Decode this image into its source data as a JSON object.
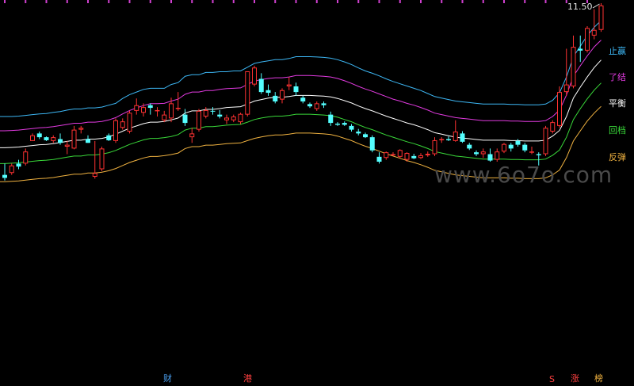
{
  "chart_data": {
    "type": "candlestick",
    "ylim": [
      4.74,
      11.56
    ],
    "last_price_label": "11.50",
    "watermark": "www.6o7o.com",
    "band_labels": [
      {
        "text": "止赢",
        "color": "#3db7f5"
      },
      {
        "text": "了结",
        "color": "#e23ae0"
      },
      {
        "text": "平衡",
        "color": "#ffffff"
      },
      {
        "text": "回档",
        "color": "#39d839"
      },
      {
        "text": "反弹",
        "color": "#f0b240"
      }
    ],
    "bottom_markers": [
      {
        "text": "财",
        "color": "#4a9ff0"
      },
      {
        "text": "港",
        "color": "#ff4040"
      },
      {
        "text": "S",
        "color": "#ff4040"
      },
      {
        "text": "涨",
        "color": "#ff4040"
      },
      {
        "text": "榜",
        "color": "#f0b240"
      }
    ],
    "candles": [
      [
        7.0,
        7.3,
        6.85,
        6.92
      ],
      [
        7.05,
        7.3,
        7.0,
        7.25
      ],
      [
        7.3,
        7.4,
        7.15,
        7.22
      ],
      [
        7.3,
        7.7,
        7.25,
        7.62
      ],
      [
        7.9,
        8.1,
        7.9,
        8.05
      ],
      [
        8.1,
        8.15,
        7.95,
        8.0
      ],
      [
        8.0,
        8.02,
        7.9,
        7.92
      ],
      [
        7.9,
        8.05,
        7.85,
        8.0
      ],
      [
        7.95,
        8.1,
        7.8,
        7.85
      ],
      [
        7.75,
        7.9,
        7.55,
        7.8
      ],
      [
        7.7,
        8.3,
        7.68,
        8.2
      ],
      [
        8.2,
        8.3,
        8.1,
        8.25
      ],
      [
        7.95,
        8.05,
        7.85,
        7.85
      ],
      [
        6.95,
        7.9,
        6.9,
        7.05
      ],
      [
        7.15,
        7.75,
        7.1,
        7.7
      ],
      [
        8.05,
        8.1,
        7.9,
        7.92
      ],
      [
        7.9,
        8.5,
        7.85,
        8.45
      ],
      [
        8.25,
        8.5,
        8.2,
        8.42
      ],
      [
        8.15,
        8.7,
        8.1,
        8.65
      ],
      [
        8.7,
        9.03,
        8.6,
        8.85
      ],
      [
        8.65,
        8.9,
        8.55,
        8.8
      ],
      [
        8.85,
        8.9,
        8.6,
        8.78
      ],
      [
        8.7,
        8.8,
        8.55,
        8.72
      ],
      [
        8.45,
        8.7,
        8.4,
        8.6
      ],
      [
        8.5,
        9.05,
        8.4,
        8.9
      ],
      [
        8.75,
        9.2,
        8.7,
        8.78
      ],
      [
        8.6,
        8.75,
        8.3,
        8.38
      ],
      [
        8.0,
        8.25,
        7.85,
        8.1
      ],
      [
        8.2,
        8.75,
        8.15,
        8.7
      ],
      [
        8.55,
        8.8,
        8.5,
        8.72
      ],
      [
        8.7,
        8.8,
        8.6,
        8.68
      ],
      [
        8.6,
        8.72,
        8.5,
        8.55
      ],
      [
        8.45,
        8.6,
        8.35,
        8.52
      ],
      [
        8.45,
        8.6,
        8.4,
        8.55
      ],
      [
        8.4,
        8.65,
        8.35,
        8.62
      ],
      [
        8.6,
        9.75,
        8.55,
        9.75
      ],
      [
        9.4,
        9.9,
        9.35,
        9.85
      ],
      [
        9.55,
        9.7,
        9.15,
        9.2
      ],
      [
        9.25,
        9.4,
        9.1,
        9.18
      ],
      [
        9.1,
        9.2,
        8.9,
        8.95
      ],
      [
        9.0,
        9.3,
        8.9,
        9.25
      ],
      [
        9.35,
        9.6,
        9.25,
        9.4
      ],
      [
        9.35,
        9.45,
        9.1,
        9.2
      ],
      [
        9.05,
        9.1,
        8.9,
        8.95
      ],
      [
        8.88,
        8.92,
        8.78,
        8.82
      ],
      [
        8.75,
        8.95,
        8.7,
        8.9
      ],
      [
        8.9,
        8.95,
        8.78,
        8.85
      ],
      [
        8.6,
        8.68,
        8.3,
        8.38
      ],
      [
        8.36,
        8.4,
        8.3,
        8.33
      ],
      [
        8.38,
        8.42,
        8.3,
        8.33
      ],
      [
        8.3,
        8.35,
        8.15,
        8.2
      ],
      [
        8.15,
        8.22,
        8.05,
        8.1
      ],
      [
        8.08,
        8.12,
        7.98,
        8.0
      ],
      [
        8.0,
        8.05,
        7.6,
        7.65
      ],
      [
        7.48,
        7.6,
        7.3,
        7.35
      ],
      [
        7.45,
        7.62,
        7.4,
        7.6
      ],
      [
        7.55,
        7.6,
        7.5,
        7.55
      ],
      [
        7.48,
        7.68,
        7.44,
        7.66
      ],
      [
        7.4,
        7.6,
        7.35,
        7.58
      ],
      [
        7.5,
        7.56,
        7.42,
        7.44
      ],
      [
        7.45,
        7.58,
        7.42,
        7.52
      ],
      [
        7.52,
        7.62,
        7.48,
        7.56
      ],
      [
        7.55,
        8.0,
        7.5,
        7.92
      ],
      [
        7.92,
        8.0,
        7.85,
        7.95
      ],
      [
        7.95,
        8.02,
        7.9,
        7.92
      ],
      [
        7.9,
        8.45,
        7.88,
        8.15
      ],
      [
        8.1,
        8.16,
        7.85,
        7.88
      ],
      [
        7.8,
        7.85,
        7.66,
        7.7
      ],
      [
        7.6,
        7.65,
        7.5,
        7.55
      ],
      [
        7.55,
        7.7,
        7.45,
        7.62
      ],
      [
        7.55,
        7.7,
        7.35,
        7.38
      ],
      [
        7.4,
        7.7,
        7.35,
        7.62
      ],
      [
        7.62,
        7.85,
        7.58,
        7.82
      ],
      [
        7.8,
        7.85,
        7.62,
        7.7
      ],
      [
        7.9,
        7.95,
        7.75,
        7.8
      ],
      [
        7.8,
        7.85,
        7.6,
        7.65
      ],
      [
        7.6,
        7.75,
        7.55,
        7.62
      ],
      [
        7.55,
        7.6,
        7.25,
        7.52
      ],
      [
        7.55,
        8.3,
        7.5,
        8.25
      ],
      [
        8.15,
        8.45,
        8.1,
        8.4
      ],
      [
        8.3,
        9.35,
        8.25,
        9.2
      ],
      [
        9.2,
        10.35,
        9.1,
        9.4
      ],
      [
        9.35,
        10.7,
        9.3,
        10.4
      ],
      [
        10.35,
        10.7,
        10.0,
        10.3
      ],
      [
        10.3,
        10.95,
        10.25,
        10.9
      ],
      [
        10.7,
        11.4,
        10.6,
        10.85
      ],
      [
        10.85,
        11.56,
        10.8,
        11.5
      ]
    ],
    "bands": {
      "profit": [
        8.55,
        8.55,
        8.56,
        8.58,
        8.6,
        8.62,
        8.63,
        8.66,
        8.68,
        8.72,
        8.75,
        8.75,
        8.78,
        8.78,
        8.8,
        8.85,
        8.9,
        9.03,
        9.13,
        9.2,
        9.27,
        9.3,
        9.3,
        9.3,
        9.4,
        9.45,
        9.62,
        9.66,
        9.66,
        9.72,
        9.72,
        9.74,
        9.74,
        9.76,
        9.76,
        9.86,
        9.96,
        10.0,
        10.03,
        10.06,
        10.06,
        10.09,
        10.14,
        10.14,
        10.14,
        10.13,
        10.12,
        10.1,
        10.06,
        10.0,
        9.93,
        9.84,
        9.76,
        9.7,
        9.63,
        9.55,
        9.48,
        9.42,
        9.36,
        9.3,
        9.24,
        9.16,
        9.08,
        9.04,
        9.0,
        8.96,
        8.94,
        8.92,
        8.9,
        8.88,
        8.88,
        8.88,
        8.88,
        8.87,
        8.87,
        8.86,
        8.86,
        8.86,
        8.88,
        8.98,
        9.18,
        9.6,
        10.14,
        10.42,
        10.7,
        10.92,
        11.1
      ],
      "close": [
        8.17,
        8.18,
        8.19,
        8.21,
        8.23,
        8.25,
        8.26,
        8.28,
        8.31,
        8.34,
        8.37,
        8.37,
        8.4,
        8.4,
        8.42,
        8.46,
        8.52,
        8.62,
        8.71,
        8.78,
        8.84,
        8.89,
        8.89,
        8.9,
        8.96,
        9.01,
        9.14,
        9.2,
        9.2,
        9.24,
        9.24,
        9.27,
        9.29,
        9.3,
        9.31,
        9.4,
        9.49,
        9.53,
        9.56,
        9.58,
        9.58,
        9.6,
        9.64,
        9.64,
        9.64,
        9.63,
        9.62,
        9.6,
        9.56,
        9.5,
        9.43,
        9.35,
        9.28,
        9.22,
        9.15,
        9.08,
        9.01,
        8.96,
        8.9,
        8.85,
        8.79,
        8.72,
        8.64,
        8.6,
        8.56,
        8.52,
        8.5,
        8.48,
        8.46,
        8.44,
        8.44,
        8.44,
        8.44,
        8.43,
        8.43,
        8.42,
        8.42,
        8.42,
        8.44,
        8.55,
        8.72,
        9.12,
        9.62,
        9.9,
        10.16,
        10.4,
        10.58
      ],
      "balance": [
        7.72,
        7.73,
        7.74,
        7.76,
        7.78,
        7.8,
        7.81,
        7.83,
        7.86,
        7.89,
        7.92,
        7.92,
        7.95,
        7.95,
        7.97,
        8.01,
        8.08,
        8.16,
        8.24,
        8.3,
        8.36,
        8.4,
        8.4,
        8.42,
        8.46,
        8.51,
        8.64,
        8.7,
        8.7,
        8.74,
        8.74,
        8.76,
        8.79,
        8.8,
        8.81,
        8.88,
        8.96,
        9.0,
        9.04,
        9.06,
        9.06,
        9.08,
        9.11,
        9.11,
        9.11,
        9.1,
        9.09,
        9.07,
        9.03,
        8.97,
        8.91,
        8.83,
        8.76,
        8.7,
        8.63,
        8.56,
        8.5,
        8.44,
        8.38,
        8.33,
        8.27,
        8.2,
        8.12,
        8.08,
        8.04,
        8.0,
        7.98,
        7.96,
        7.94,
        7.92,
        7.92,
        7.92,
        7.92,
        7.91,
        7.91,
        7.9,
        7.9,
        7.9,
        7.92,
        8.03,
        8.18,
        8.55,
        9.04,
        9.33,
        9.6,
        9.85,
        10.05
      ],
      "pullback": [
        7.3,
        7.31,
        7.32,
        7.34,
        7.36,
        7.38,
        7.39,
        7.41,
        7.44,
        7.47,
        7.5,
        7.5,
        7.53,
        7.53,
        7.55,
        7.59,
        7.65,
        7.73,
        7.81,
        7.87,
        7.93,
        7.97,
        7.97,
        7.99,
        8.02,
        8.07,
        8.19,
        8.24,
        8.24,
        8.28,
        8.28,
        8.3,
        8.32,
        8.33,
        8.34,
        8.4,
        8.47,
        8.51,
        8.54,
        8.56,
        8.56,
        8.58,
        8.61,
        8.61,
        8.61,
        8.6,
        8.59,
        8.57,
        8.53,
        8.47,
        8.41,
        8.33,
        8.26,
        8.2,
        8.13,
        8.06,
        8.0,
        7.94,
        7.88,
        7.83,
        7.77,
        7.7,
        7.62,
        7.58,
        7.54,
        7.5,
        7.48,
        7.46,
        7.44,
        7.42,
        7.42,
        7.42,
        7.42,
        7.41,
        7.41,
        7.4,
        7.4,
        7.4,
        7.42,
        7.52,
        7.66,
        8.0,
        8.47,
        8.76,
        9.02,
        9.25,
        9.44
      ],
      "rebound": [
        6.82,
        6.83,
        6.84,
        6.86,
        6.88,
        6.9,
        6.91,
        6.93,
        6.96,
        6.99,
        7.02,
        7.02,
        7.05,
        7.05,
        7.07,
        7.11,
        7.17,
        7.25,
        7.33,
        7.39,
        7.45,
        7.49,
        7.49,
        7.51,
        7.54,
        7.58,
        7.7,
        7.75,
        7.75,
        7.79,
        7.79,
        7.81,
        7.83,
        7.84,
        7.85,
        7.91,
        7.97,
        8.01,
        8.04,
        8.06,
        8.06,
        8.08,
        8.11,
        8.11,
        8.11,
        8.1,
        8.09,
        8.07,
        8.03,
        7.97,
        7.91,
        7.83,
        7.76,
        7.7,
        7.63,
        7.56,
        7.5,
        7.44,
        7.38,
        7.33,
        7.27,
        7.2,
        7.12,
        7.08,
        7.04,
        7.0,
        6.98,
        6.96,
        6.94,
        6.92,
        6.92,
        6.92,
        6.92,
        6.91,
        6.91,
        6.9,
        6.9,
        6.9,
        6.92,
        7.0,
        7.13,
        7.46,
        7.9,
        8.17,
        8.43,
        8.64,
        8.82
      ]
    },
    "colors": {
      "up": "#ff3232",
      "down": "#54ffff",
      "profit": "#3db7f5",
      "close": "#e23ae0",
      "balance": "#ffffff",
      "pullback": "#39d839",
      "rebound": "#f0b240",
      "top_ticks": "#d040d0"
    }
  }
}
